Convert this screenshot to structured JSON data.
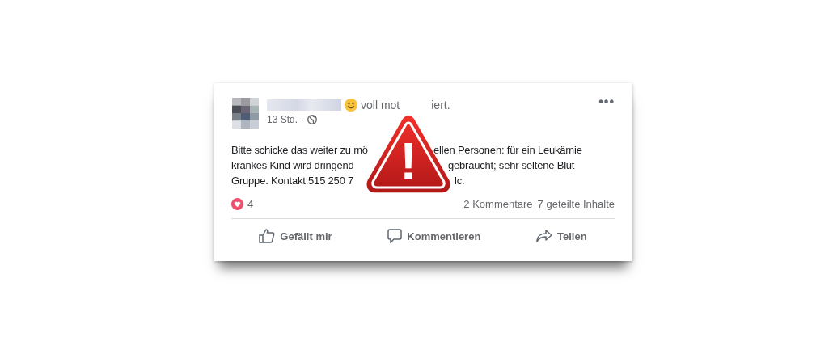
{
  "post": {
    "status": [
      "voll mot",
      "iert."
    ],
    "more": "•••",
    "time": "13 Std.",
    "separator": "·",
    "public": true,
    "body": [
      {
        "left": "Bitte schicke das weiter zu mö",
        "right": "ellen Personen: für ein Leukämie"
      },
      {
        "left": "krankes Kind wird dringend",
        "right": "gebraucht; sehr seltene Blut"
      },
      {
        "left": "Gruppe. Kontakt:515 250 7",
        "right": "lc."
      }
    ],
    "reactions": {
      "count": "4"
    },
    "comments": "2 Kommentare",
    "shares": "7 geteilte Inhalte",
    "actions": [
      {
        "kind": "like",
        "label": "Gefällt mir"
      },
      {
        "kind": "comment",
        "label": "Kommentieren"
      },
      {
        "kind": "share",
        "label": "Teilen"
      }
    ]
  },
  "warning": {
    "symbol": "!"
  }
}
